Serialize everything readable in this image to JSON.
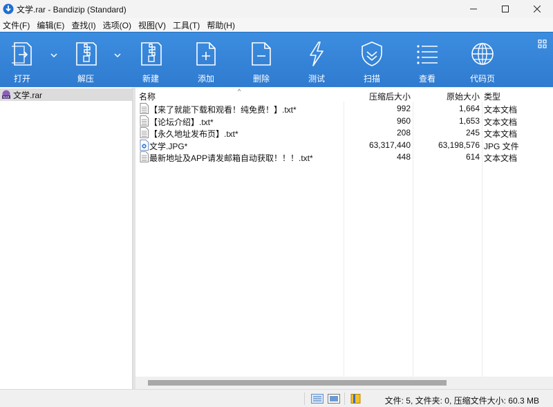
{
  "window": {
    "title": "文学.rar - Bandizip (Standard)",
    "minimize_glyph": "—",
    "maximize_glyph": "☐",
    "close_glyph": "✕"
  },
  "menu": [
    "文件(F)",
    "编辑(E)",
    "查找(I)",
    "选项(O)",
    "视图(V)",
    "工具(T)",
    "帮助(H)"
  ],
  "toolbar": {
    "open": "打开",
    "extract": "解压",
    "new": "新建",
    "add": "添加",
    "delete": "删除",
    "test": "测试",
    "scan": "扫描",
    "view": "查看",
    "codepage": "代码页"
  },
  "tree": {
    "root_label": "文学.rar"
  },
  "list": {
    "headers": {
      "name": "名称",
      "compressed": "压缩后大小",
      "original": "原始大小",
      "type": "类型",
      "sort_arrow": "^"
    },
    "rows": [
      {
        "name": "【来了就能下载和观看！纯免费！】.txt*",
        "compressed": "992",
        "original": "1,664",
        "type": "文本文档",
        "icon": "text-file-icon"
      },
      {
        "name": "【论坛介绍】.txt*",
        "compressed": "960",
        "original": "1,653",
        "type": "文本文档",
        "icon": "text-file-icon"
      },
      {
        "name": "【永久地址发布页】.txt*",
        "compressed": "208",
        "original": "245",
        "type": "文本文档",
        "icon": "text-file-icon"
      },
      {
        "name": "文学.JPG*",
        "compressed": "63,317,440",
        "original": "63,198,576",
        "type": "JPG 文件",
        "icon": "image-file-icon"
      },
      {
        "name": "最新地址及APP请发邮箱自动获取！！！.txt*",
        "compressed": "448",
        "original": "614",
        "type": "文本文档",
        "icon": "text-file-icon"
      }
    ]
  },
  "status": {
    "text": "文件: 5, 文件夹: 0, 压缩文件大小: 60.3 MB"
  },
  "colors": {
    "toolbar_blue": "#3283d6",
    "selection_gray": "#dcdcdc"
  }
}
